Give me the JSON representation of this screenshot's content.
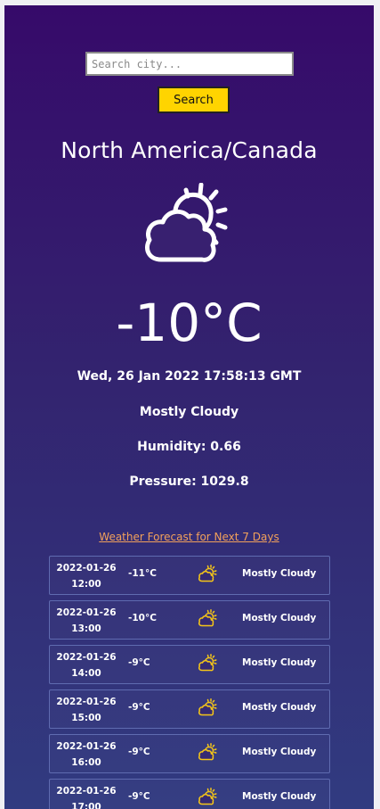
{
  "search": {
    "placeholder": "Search city...",
    "value": "",
    "button_label": "Search"
  },
  "current": {
    "location": "North America/Canada",
    "icon": "cloud-sun-icon",
    "temperature": "-10°C",
    "datetime": "Wed, 26 Jan 2022 17:58:13 GMT",
    "condition": "Mostly Cloudy",
    "humidity": "Humidity: 0.66",
    "pressure": "Pressure: 1029.8"
  },
  "forecast": {
    "title": "Weather Forecast for Next 7 Days",
    "rows": [
      {
        "date": "2022-01-26",
        "time": "12:00",
        "temp": "-11°C",
        "icon": "cloud-sun-icon",
        "condition": "Mostly Cloudy"
      },
      {
        "date": "2022-01-26",
        "time": "13:00",
        "temp": "-10°C",
        "icon": "cloud-sun-icon",
        "condition": "Mostly Cloudy"
      },
      {
        "date": "2022-01-26",
        "time": "14:00",
        "temp": "-9°C",
        "icon": "cloud-sun-icon",
        "condition": "Mostly Cloudy"
      },
      {
        "date": "2022-01-26",
        "time": "15:00",
        "temp": "-9°C",
        "icon": "cloud-sun-icon",
        "condition": "Mostly Cloudy"
      },
      {
        "date": "2022-01-26",
        "time": "16:00",
        "temp": "-9°C",
        "icon": "cloud-sun-icon",
        "condition": "Mostly Cloudy"
      },
      {
        "date": "2022-01-26",
        "time": "17:00",
        "temp": "-9°C",
        "icon": "cloud-sun-icon",
        "condition": "Mostly Cloudy"
      }
    ]
  },
  "colors": {
    "accent_yellow": "#ffd400",
    "forecast_icon": "#f5c518",
    "link_orange": "#f2a15b"
  }
}
